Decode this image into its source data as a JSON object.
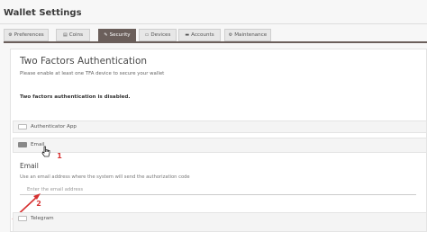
{
  "page": {
    "title": "Wallet Settings"
  },
  "tabs": [
    {
      "label": "Preferences",
      "icon": "gear-icon",
      "glyph": "⚙"
    },
    {
      "label": "Coins",
      "icon": "coins-icon",
      "glyph": "▤"
    },
    {
      "label": "Security",
      "icon": "key-icon",
      "glyph": "✎",
      "active": true
    },
    {
      "label": "Devices",
      "icon": "devices-icon",
      "glyph": "▭"
    },
    {
      "label": "Accounts",
      "icon": "folder-icon",
      "glyph": "▬"
    },
    {
      "label": "Maintenance",
      "icon": "wrench-icon",
      "glyph": "⚙"
    }
  ],
  "tfa": {
    "title": "Two Factors Authentication",
    "subtitle": "Please enable at least one TFA device to secure your wallet",
    "status": "Two factors authentication is disabled."
  },
  "methods": {
    "authenticator": {
      "label": "Authenticator App",
      "enabled": false
    },
    "email": {
      "label": "Email",
      "enabled": true
    },
    "telegram": {
      "label": "Telegram",
      "enabled": false
    }
  },
  "email_form": {
    "label": "Email",
    "help": "Use an email address where the system will send the authorization code",
    "placeholder": "Enter the email address",
    "value": ""
  },
  "annotations": {
    "step1": "1",
    "step2": "2"
  },
  "colors": {
    "accent": "#6b5f5b",
    "annotation": "#d63030",
    "panel_bg": "#ffffff",
    "page_bg": "#f7f7f7"
  }
}
